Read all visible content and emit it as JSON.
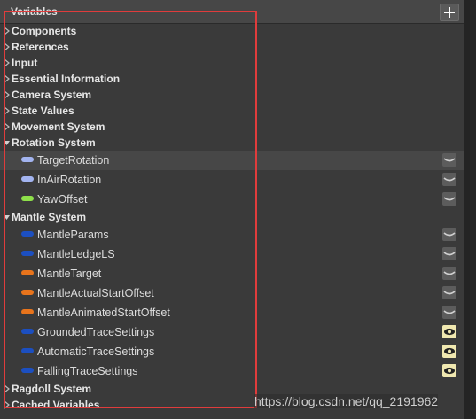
{
  "panel": {
    "title": "Variables",
    "add_icon": "plus-icon"
  },
  "categories": {
    "components": "Components",
    "references": "References",
    "input": "Input",
    "essential": "Essential Information",
    "camera": "Camera System",
    "state": "State Values",
    "movement": "Movement System",
    "rotation": "Rotation System",
    "mantle": "Mantle System",
    "ragdoll": "Ragdoll System",
    "cached": "Cached Variables"
  },
  "rotation_vars": [
    {
      "name": "TargetRotation",
      "color": "#a3b4f0",
      "visibility": "closed-eye-icon"
    },
    {
      "name": "InAirRotation",
      "color": "#a3b4f0",
      "visibility": "closed-eye-icon"
    },
    {
      "name": "YawOffset",
      "color": "#8ee04a",
      "visibility": "closed-eye-icon"
    }
  ],
  "mantle_vars": [
    {
      "name": "MantleParams",
      "color": "#1c4fc0",
      "visibility": "closed-eye-icon"
    },
    {
      "name": "MantleLedgeLS",
      "color": "#1c4fc0",
      "visibility": "closed-eye-icon"
    },
    {
      "name": "MantleTarget",
      "color": "#e8741c",
      "visibility": "closed-eye-icon"
    },
    {
      "name": "MantleActualStartOffset",
      "color": "#e8741c",
      "visibility": "closed-eye-icon"
    },
    {
      "name": "MantleAnimatedStartOffset",
      "color": "#e8741c",
      "visibility": "closed-eye-icon"
    },
    {
      "name": "GroundedTraceSettings",
      "color": "#1c4fc0",
      "visibility": "open-eye-icon"
    },
    {
      "name": "AutomaticTraceSettings",
      "color": "#1c4fc0",
      "visibility": "open-eye-icon"
    },
    {
      "name": "FallingTraceSettings",
      "color": "#1c4fc0",
      "visibility": "open-eye-icon"
    }
  ],
  "watermark": "https://blog.csdn.net/qq_2191962"
}
